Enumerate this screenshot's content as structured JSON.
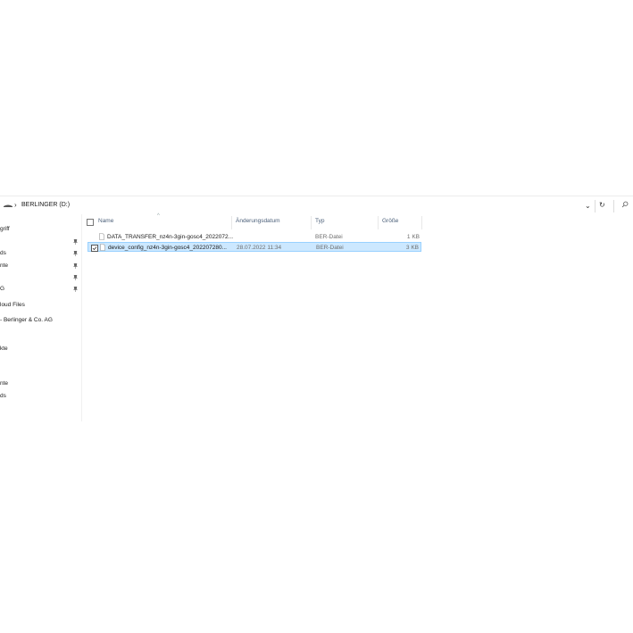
{
  "address": {
    "location": "BERLINGER (D:)",
    "icons": [
      "drive-icon",
      "chevron-right-icon",
      "chevron-down-icon",
      "refresh-icon",
      "search-icon"
    ]
  },
  "nav": {
    "items": [
      {
        "label": "griff",
        "pinned": false
      },
      {
        "label": "",
        "pinned": true
      },
      {
        "label": "ds",
        "pinned": true
      },
      {
        "label": "nte",
        "pinned": true
      },
      {
        "label": "",
        "pinned": true
      },
      {
        "label": "G",
        "pinned": true
      },
      {
        "label": "loud Files",
        "pinned": false
      },
      {
        "label": "- Berlinger & Co. AG",
        "pinned": false
      },
      {
        "label": "kte",
        "pinned": false
      },
      {
        "label": "nte",
        "pinned": false
      },
      {
        "label": "ds",
        "pinned": false
      }
    ]
  },
  "columns": {
    "name": "Name",
    "date": "Änderungsdatum",
    "type": "Typ",
    "size": "Größe"
  },
  "files": [
    {
      "name": "DATA_TRANSFER_nz4n-3gin-gosc4_2022072...",
      "date": "",
      "type": "BER-Datei",
      "size": "1 KB",
      "selected": false
    },
    {
      "name": "device_config_nz4n-3gin-gosc4_202207280...",
      "date": "28.07.2022 11:34",
      "type": "BER-Datei",
      "size": "3 KB",
      "selected": true
    }
  ]
}
